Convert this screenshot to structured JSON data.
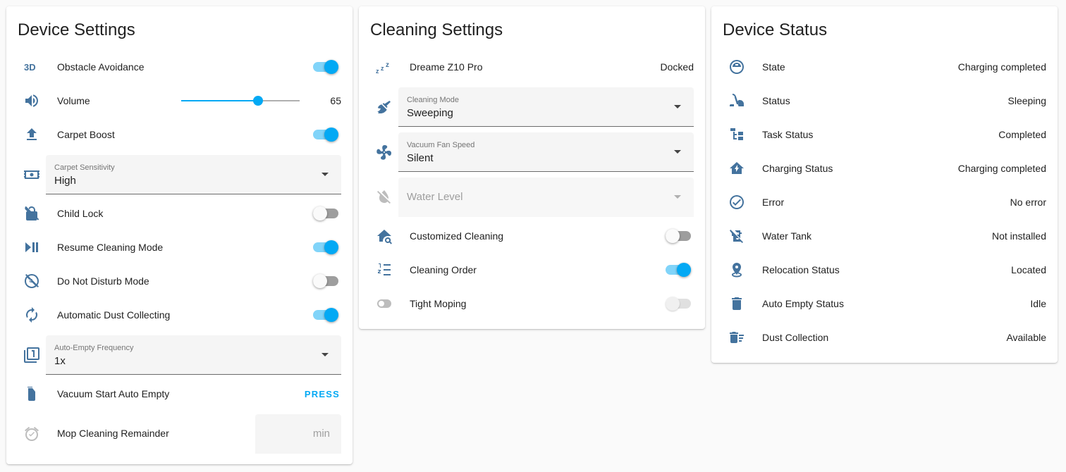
{
  "colors": {
    "icon": "#44739e",
    "accent": "#03a9f4",
    "background": "#fafafa"
  },
  "device_settings": {
    "title": "Device Settings",
    "obstacle_avoidance": {
      "icon": "3d-icon",
      "label": "Obstacle Avoidance",
      "on": true
    },
    "volume": {
      "icon": "volume-icon",
      "label": "Volume",
      "value": "65",
      "level": 0.65
    },
    "carpet_boost": {
      "icon": "upload-icon",
      "label": "Carpet Boost",
      "on": true
    },
    "carpet_sensitivity": {
      "icon": "carpet-icon",
      "field_label": "Carpet Sensitivity",
      "value": "High"
    },
    "child_lock": {
      "icon": "lock-off-icon",
      "label": "Child Lock",
      "on": false
    },
    "resume_cleaning": {
      "icon": "play-pause-icon",
      "label": "Resume Cleaning Mode",
      "on": true
    },
    "do_not_disturb": {
      "icon": "sleep-off-icon",
      "label": "Do Not Disturb Mode",
      "on": false
    },
    "auto_dust": {
      "icon": "autorenew-icon",
      "label": "Automatic Dust Collecting",
      "on": true
    },
    "auto_empty_frequency": {
      "icon": "filter-1-icon",
      "field_label": "Auto-Empty Frequency",
      "value": "1x"
    },
    "vacuum_start_auto_empty": {
      "icon": "trash-can-icon",
      "label": "Vacuum Start Auto Empty",
      "action": "PRESS"
    },
    "mop_cleaning_remainder": {
      "icon": "alarm-check-icon",
      "label": "Mop Cleaning Remainder",
      "suffix": "min"
    }
  },
  "cleaning_settings": {
    "title": "Cleaning Settings",
    "device": {
      "icon": "sleep-icon",
      "label": "Dreame Z10 Pro",
      "value": "Docked"
    },
    "cleaning_mode": {
      "icon": "broom-icon",
      "field_label": "Cleaning Mode",
      "value": "Sweeping"
    },
    "fan_speed": {
      "icon": "fan-icon",
      "field_label": "Vacuum Fan Speed",
      "value": "Silent"
    },
    "water_level": {
      "icon": "water-off-icon",
      "placeholder": "Water Level"
    },
    "customized_cleaning": {
      "icon": "home-search-icon",
      "label": "Customized Cleaning",
      "on": false
    },
    "cleaning_order": {
      "icon": "order-numeric-icon",
      "label": "Cleaning Order",
      "on": true
    },
    "tight_moping": {
      "icon": "toggle-switch-icon",
      "label": "Tight Moping",
      "on": false
    }
  },
  "device_status": {
    "title": "Device Status",
    "items": [
      {
        "icon": "robot-vacuum-icon",
        "label": "State",
        "value": "Charging completed"
      },
      {
        "icon": "vacuum-cleaner-icon",
        "label": "Status",
        "value": "Sleeping"
      },
      {
        "icon": "file-tree-icon",
        "label": "Task Status",
        "value": "Completed"
      },
      {
        "icon": "home-lightning-icon",
        "label": "Charging Status",
        "value": "Charging completed"
      },
      {
        "icon": "check-circle-icon",
        "label": "Error",
        "value": "No error"
      },
      {
        "icon": "water-tank-off-icon",
        "label": "Water Tank",
        "value": "Not installed"
      },
      {
        "icon": "map-marker-icon",
        "label": "Relocation Status",
        "value": "Located"
      },
      {
        "icon": "delete-icon",
        "label": "Auto Empty Status",
        "value": "Idle"
      },
      {
        "icon": "delete-sweep-icon",
        "label": "Dust Collection",
        "value": "Available"
      }
    ]
  }
}
